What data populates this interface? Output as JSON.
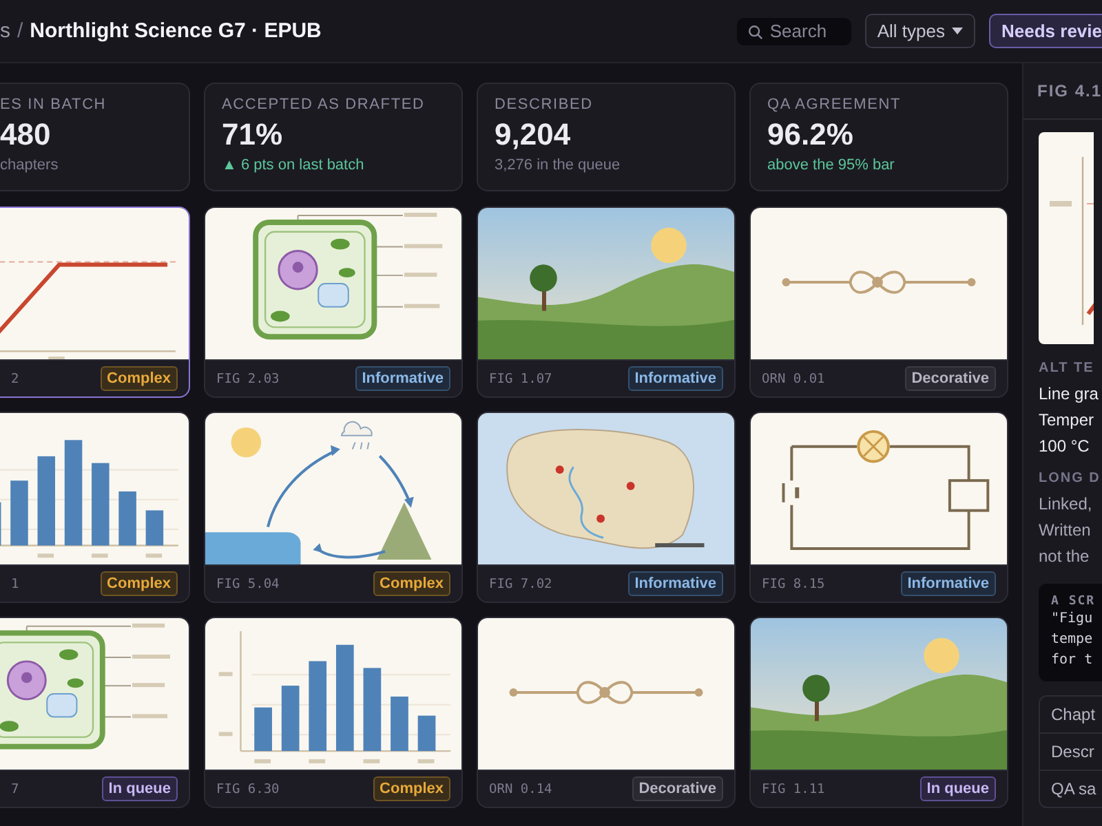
{
  "topbar": {
    "breadcrumb": [
      {
        "label": "s",
        "current": false
      },
      {
        "label": "Northlight Science G7 · EPUB",
        "current": true
      }
    ],
    "separator": "/",
    "search": {
      "placeholder": "Search"
    },
    "filter": {
      "label": "All types"
    },
    "action": {
      "label": "Needs revie"
    }
  },
  "stats": [
    {
      "label": "ES IN BATCH",
      "value": "480",
      "note": "chapters",
      "kind": "muted"
    },
    {
      "label": "ACCEPTED AS DRAFTED",
      "value": "71%",
      "note": "▲ 6 pts on last batch",
      "kind": "positive"
    },
    {
      "label": "DESCRIBED",
      "value": "9,204",
      "note": "3,276 in the queue",
      "kind": "muted"
    },
    {
      "label": "QA AGREEMENT",
      "value": "96.2%",
      "note": "above the 95% bar",
      "kind": "positive"
    }
  ],
  "figures": [
    {
      "kind": "line-graph",
      "id": "2",
      "badge": {
        "kind": "complex",
        "label": "Complex"
      },
      "selected": true
    },
    {
      "kind": "cell",
      "id": "FIG 2.03",
      "badge": {
        "kind": "informative",
        "label": "Informative"
      },
      "selected": false
    },
    {
      "kind": "landscape",
      "id": "FIG 1.07",
      "badge": {
        "kind": "informative",
        "label": "Informative"
      },
      "selected": false
    },
    {
      "kind": "ornament",
      "id": "ORN 0.01",
      "badge": {
        "kind": "decorative",
        "label": "Decorative"
      },
      "selected": false
    },
    {
      "kind": "bar-chart",
      "id": "1",
      "badge": {
        "kind": "complex",
        "label": "Complex"
      },
      "selected": false
    },
    {
      "kind": "water-cycle",
      "id": "FIG 5.04",
      "badge": {
        "kind": "complex",
        "label": "Complex"
      },
      "selected": false
    },
    {
      "kind": "map",
      "id": "FIG 7.02",
      "badge": {
        "kind": "informative",
        "label": "Informative"
      },
      "selected": false
    },
    {
      "kind": "circuit",
      "id": "FIG 8.15",
      "badge": {
        "kind": "informative",
        "label": "Informative"
      },
      "selected": false
    },
    {
      "kind": "cell",
      "id": "7",
      "badge": {
        "kind": "queue",
        "label": "In queue"
      },
      "selected": false
    },
    {
      "kind": "bar-chart",
      "id": "FIG 6.30",
      "badge": {
        "kind": "complex",
        "label": "Complex"
      },
      "selected": false
    },
    {
      "kind": "ornament",
      "id": "ORN 0.14",
      "badge": {
        "kind": "decorative",
        "label": "Decorative"
      },
      "selected": false
    },
    {
      "kind": "landscape",
      "id": "FIG 1.11",
      "badge": {
        "kind": "queue",
        "label": "In queue"
      },
      "selected": false
    }
  ],
  "panel": {
    "title": "FIG 4.1",
    "alt_heading": "ALT TE",
    "alt_lines": [
      "Line gra",
      "Temper",
      "100 °C"
    ],
    "long_heading": "LONG D",
    "long_lines": [
      "Linked,",
      "Written",
      "not the"
    ],
    "code_heading": "A SCR",
    "code_lines": [
      "\"Figu",
      "tempe",
      "for t"
    ],
    "rows": [
      "Chapt",
      "Descr",
      "QA sa"
    ]
  }
}
